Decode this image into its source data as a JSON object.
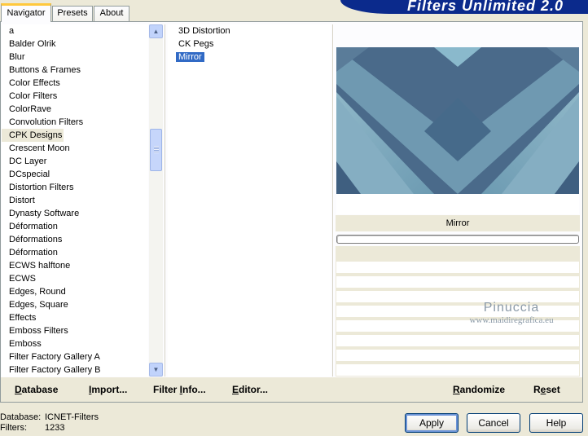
{
  "banner": {
    "title": "Filters Unlimited 2.0"
  },
  "tabs": [
    {
      "label": "Navigator",
      "active": true
    },
    {
      "label": "Presets",
      "active": false
    },
    {
      "label": "About",
      "active": false
    }
  ],
  "categories": [
    "a",
    "Balder Olrik",
    "Blur",
    "Buttons & Frames",
    "Color Effects",
    "Color Filters",
    "ColorRave",
    "Convolution Filters",
    "CPK Designs",
    "Crescent Moon",
    "DC Layer",
    "DCspecial",
    "Distortion Filters",
    "Distort",
    "Dynasty Software",
    "Déformation",
    "Déformations",
    "Déformation",
    "ECWS halftone",
    "ECWS",
    "Edges, Round",
    "Edges, Square",
    "Effects",
    "Emboss Filters",
    "Emboss",
    "Filter Factory Gallery A",
    "Filter Factory Gallery B"
  ],
  "selected_category": "CPK Designs",
  "filters": [
    "3D Distortion",
    "CK Pegs",
    "Mirror"
  ],
  "selected_filter": "Mirror",
  "preview": {
    "filter_name": "Mirror"
  },
  "watermark": {
    "line1": "Pinuccia",
    "line2": "www.maidiregrafica.eu"
  },
  "links": {
    "database_pre": "D",
    "database_post": "atabase",
    "import_pre": "I",
    "import_post": "mport...",
    "filter_info_pre": "Filter ",
    "filter_info_u": "I",
    "filter_info_post": "nfo...",
    "editor_pre": "E",
    "editor_post": "ditor...",
    "randomize_pre": "",
    "randomize_u": "R",
    "randomize_post": "andomize",
    "reset_pre": "R",
    "reset_u": "e",
    "reset_post": "set"
  },
  "status": {
    "database_label": "Database:",
    "database_value": "ICNET-Filters",
    "filters_label": "Filters:",
    "filters_value": "1233"
  },
  "buttons": {
    "apply": "Apply",
    "cancel": "Cancel",
    "help": "Help"
  },
  "colors": {
    "selection": "#316ac5",
    "banner": "#0b2a8c",
    "dialog_bg": "#ece9d8"
  }
}
